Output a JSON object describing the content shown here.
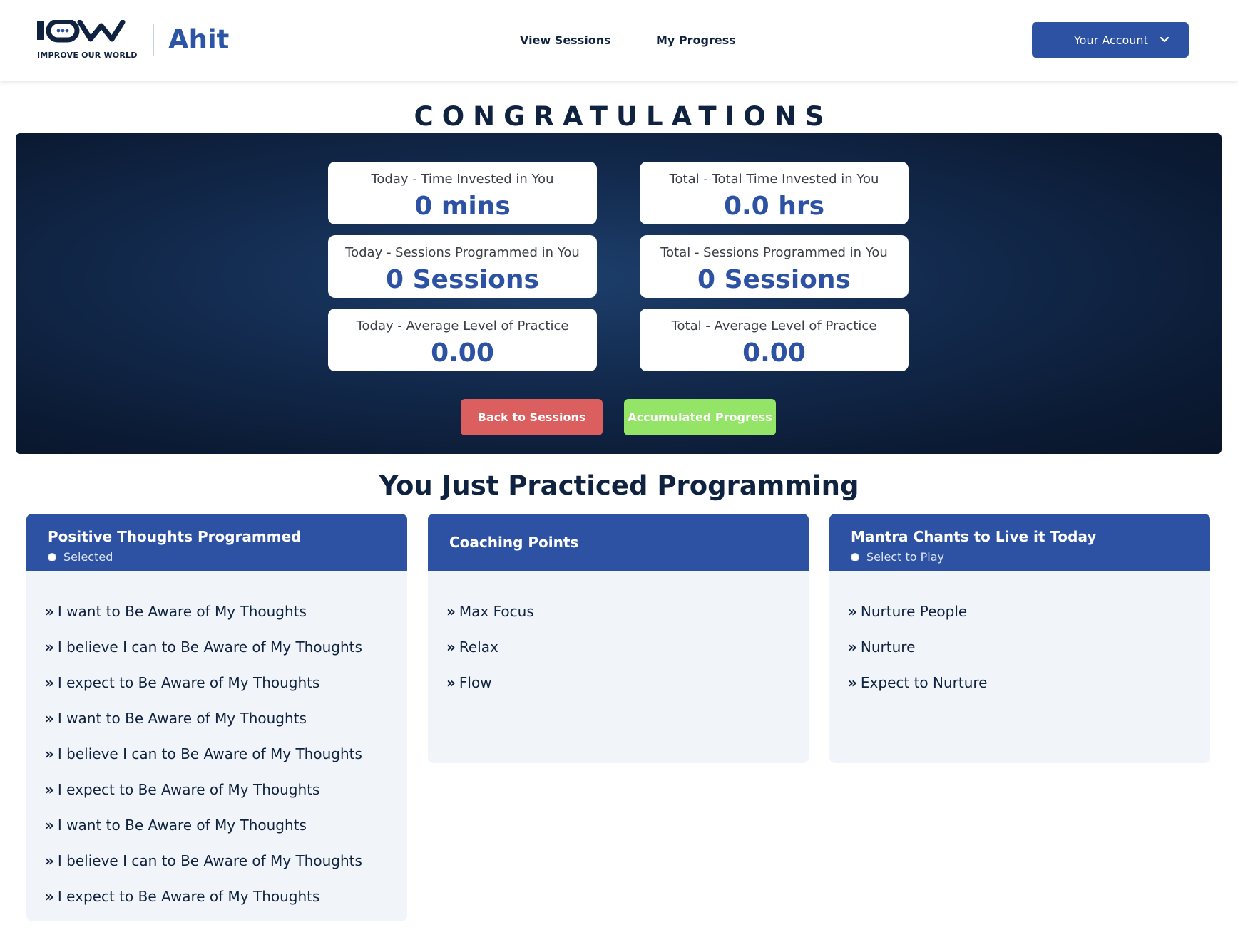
{
  "header": {
    "logo_text": "IOW",
    "logo_tagline": "IMPROVE OUR WORLD",
    "brand_name": "Ahit",
    "nav": {
      "view_sessions": "View Sessions",
      "my_progress": "My Progress"
    },
    "account_button": "Your Account",
    "account_icon": "chevron-down-icon"
  },
  "congrats": {
    "title": "CONGRATULATIONS",
    "stats": {
      "today_time": {
        "label": "Today - Time Invested in You",
        "value": "0 mins"
      },
      "total_time": {
        "label": "Total - Total Time Invested in You",
        "value": "0.0 hrs"
      },
      "today_sessions": {
        "label": "Today - Sessions Programmed in You",
        "value": "0 Sessions"
      },
      "total_sessions": {
        "label": "Total - Sessions Programmed in You",
        "value": "0 Sessions"
      },
      "today_level": {
        "label": "Today - Average Level of Practice",
        "value": "0.00"
      },
      "total_level": {
        "label": "Total - Average Level of Practice",
        "value": "0.00"
      }
    },
    "buttons": {
      "back": "Back to Sessions",
      "accumulated": "Accumulated Progress"
    }
  },
  "practice": {
    "title": "You Just Practiced Programming",
    "panels": [
      {
        "title": "Positive Thoughts Programmed",
        "sub": "Selected",
        "items": [
          "I want to Be Aware of My Thoughts",
          "I believe I can to Be Aware of My Thoughts",
          "I expect to Be Aware of My Thoughts",
          "I want to Be Aware of My Thoughts",
          "I believe I can to Be Aware of My Thoughts",
          "I expect to Be Aware of My Thoughts",
          "I want to Be Aware of My Thoughts",
          "I believe I can to Be Aware of My Thoughts",
          "I expect to Be Aware of My Thoughts"
        ]
      },
      {
        "title": "Coaching Points",
        "items": [
          "Max Focus",
          "Relax",
          "Flow"
        ]
      },
      {
        "title": "Mantra Chants to Live it Today",
        "sub": "Select to Play",
        "items": [
          "Nurture People",
          "Nurture",
          "Expect to Nurture"
        ]
      }
    ],
    "bullet": "»"
  },
  "colors": {
    "brand_blue": "#2d52a3",
    "navy": "#0f2340",
    "back_button": "#db5f5f",
    "accumulated_button": "#94e468",
    "panel_bg": "#f1f5fa"
  }
}
